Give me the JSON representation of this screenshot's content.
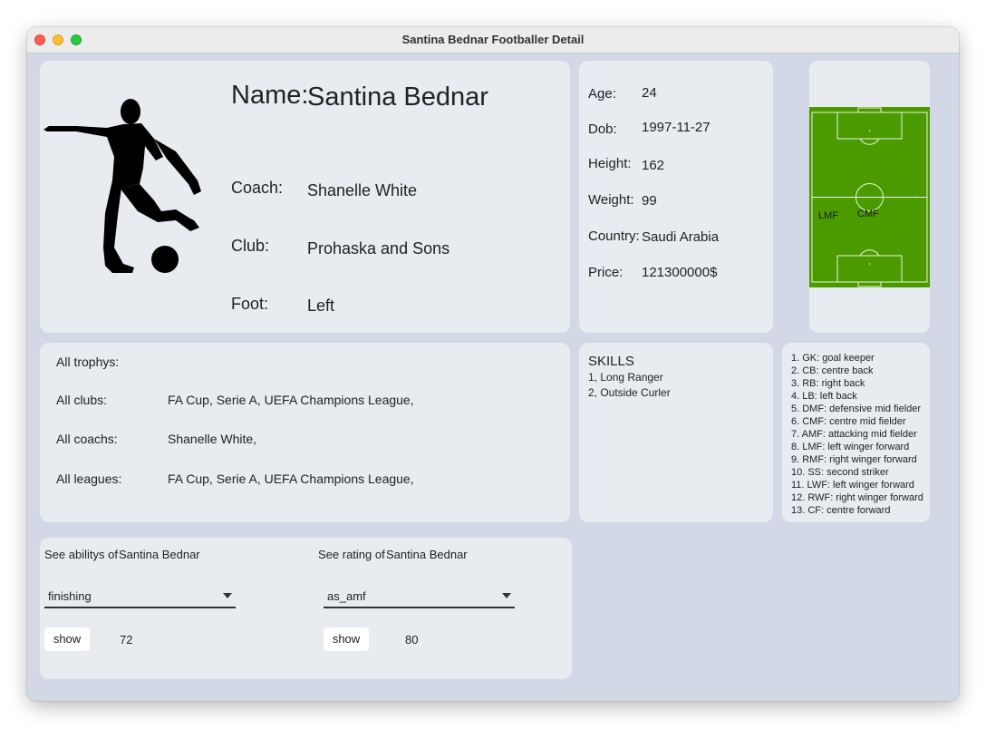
{
  "window": {
    "title": "Santina Bednar Footballer Detail"
  },
  "profile": {
    "name_label": "Name:",
    "name_value": "Santina Bednar",
    "coach_label": "Coach:",
    "coach_value": "Shanelle White",
    "club_label": "Club:",
    "club_value": "Prohaska and Sons",
    "foot_label": "Foot:",
    "foot_value": "Left"
  },
  "stats": {
    "age_label": "Age:",
    "age_value": "24",
    "dob_label": "Dob:",
    "dob_value": "1997-11-27",
    "height_label": "Height:",
    "height_value": "162",
    "weight_label": "Weight:",
    "weight_value": "99",
    "country_label": "Country:",
    "country_value": "Saudi Arabia",
    "price_label": "Price:",
    "price_value": "121300000$"
  },
  "field": {
    "positions": [
      "LMF",
      "CMF"
    ],
    "pitch_color": "#4a9a00"
  },
  "history": {
    "trophys_label": "All trophys:",
    "trophys_value": "",
    "clubs_label": "All clubs:",
    "clubs_value": "FA Cup, Serie A, UEFA Champions League,",
    "coachs_label": "All coachs:",
    "coachs_value": "Shanelle White,",
    "leagues_label": "All leagues:",
    "leagues_value": "FA Cup, Serie A, UEFA Champions League,"
  },
  "skills": {
    "title": "SKILLS",
    "items": [
      "1, Long Ranger",
      "2, Outside Curler"
    ]
  },
  "legend": {
    "items": [
      "1. GK: goal keeper",
      "2. CB: centre back",
      "3. RB: right back",
      "4. LB: left back",
      "5. DMF: defensive mid fielder",
      "6. CMF: centre mid fielder",
      "7. AMF: attacking mid fielder",
      "8. LMF: left winger forward",
      "9. RMF: right winger forward",
      "10. SS: second striker",
      "11. LWF: left winger forward",
      "12. RWF: right winger forward",
      "13. CF: centre forward"
    ]
  },
  "ability": {
    "label": "See abilitys of",
    "player": "Santina Bednar",
    "selected": "finishing",
    "button": "show",
    "result": "72"
  },
  "rating": {
    "label": "See rating of",
    "player": "Santina Bednar",
    "selected": "as_amf",
    "button": "show",
    "result": "80"
  },
  "colors": {
    "window_bg": "#d2d8e6",
    "card_bg": "#e8ebf0"
  }
}
